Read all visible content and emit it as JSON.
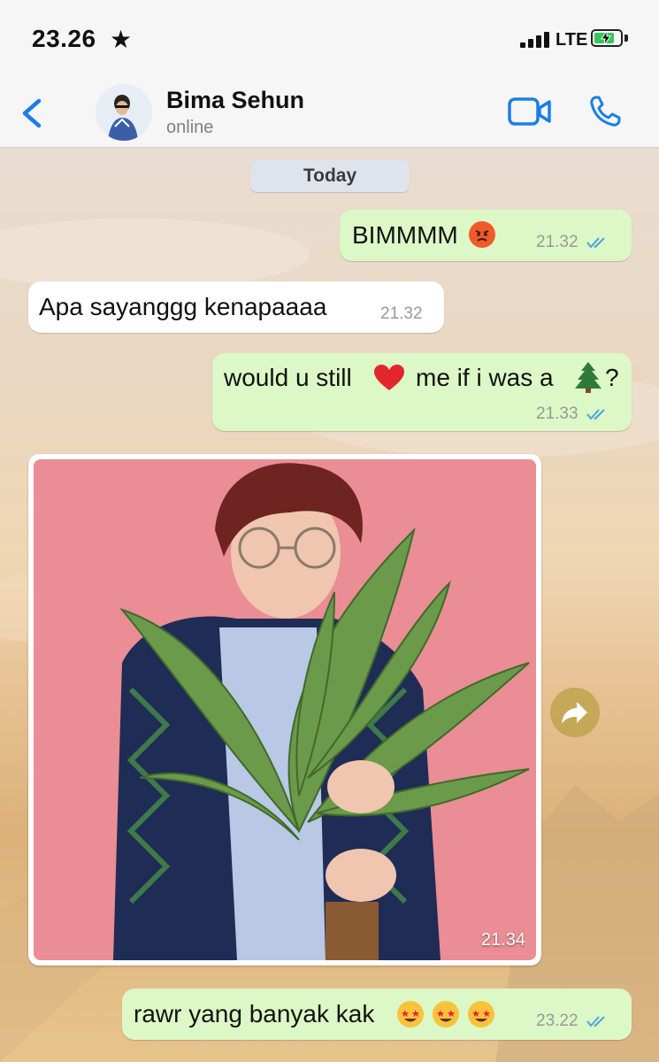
{
  "status_bar": {
    "time": "23.26",
    "network": "LTE"
  },
  "header": {
    "contact_name": "Bima Sehun",
    "contact_status": "online"
  },
  "chat": {
    "day_label": "Today",
    "messages": [
      {
        "direction": "outgoing",
        "text": "BIMMMM",
        "time": "21.32"
      },
      {
        "direction": "incoming",
        "text": "Apa sayanggg kenapaaaa",
        "time": "21.32"
      },
      {
        "direction": "outgoing",
        "text_before": "would u still",
        "text_after": "me if i was a",
        "text_end": "?",
        "time": "21.33"
      },
      {
        "direction": "incoming",
        "type": "image",
        "time": "21.34"
      },
      {
        "direction": "outgoing",
        "text": "rawr yang banyak kak",
        "time": "23.22"
      }
    ]
  },
  "colors": {
    "accent": "#1a7ee8",
    "outgoing_bubble": "#dcf8c6",
    "incoming_bubble": "#ffffff",
    "read_ticks": "#4aa3df"
  },
  "icons": [
    "star-icon",
    "signal-icon",
    "battery-icon",
    "back-chevron-icon",
    "video-call-icon",
    "phone-call-icon",
    "forward-icon",
    "read-ticks-icon",
    "angry-emoji",
    "heart-emoji",
    "tree-emoji",
    "star-struck-emoji"
  ]
}
